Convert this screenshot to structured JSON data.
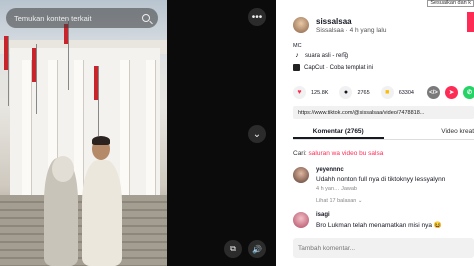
{
  "video": {
    "search_text": "Temukan konten terkait",
    "search_icon": "search-icon"
  },
  "middle": {
    "more_icon": "more-icon",
    "down_icon": "chevron-down-icon",
    "more_label": "•••",
    "down_label": "⌄",
    "pip_label": "⧉",
    "sound_label": "🔊"
  },
  "panel": {
    "tooltip": "Sesuaikan dan k",
    "username": "sissalsaa",
    "subline": "Sissalsaa · 4 h yang lalu",
    "caption": "MC",
    "sound": "suara asli - ren͡g",
    "capcut": "CapCut · Coba templat ini",
    "stats": {
      "likes": "125.8K",
      "comments": "2765",
      "saves": "63304"
    },
    "link": "https://www.tiktok.com/@sissalsaa/video/7478818...",
    "tabs": {
      "comments": "Komentar (2765)",
      "videos": "Video kreat"
    },
    "search_label": "Cari:",
    "search_suggestion": "saluran wa video bu salsa",
    "comments": [
      {
        "user": "yeyennnc",
        "text": "Udahh nonton full nya di tiktoknyy lessyalynn",
        "meta": "4 h yan…   Jawab",
        "replies": "Lihat 17 balasan ⌄"
      },
      {
        "user": "isagi",
        "text": "Bro Lukman telah menamatkan misi nya 😆"
      }
    ],
    "comment_placeholder": "Tambah komentar..."
  },
  "colors": {
    "accent": "#fe2c55",
    "whatsapp": "#25d366",
    "facebook": "#1877f2"
  }
}
